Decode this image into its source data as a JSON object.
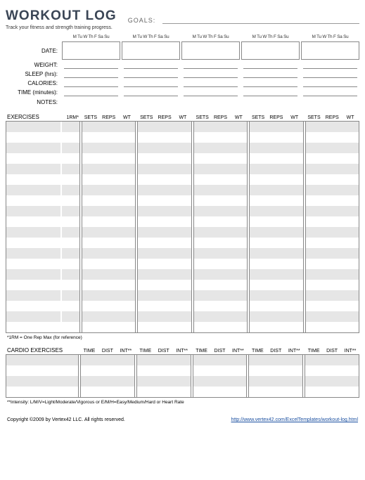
{
  "title": "WORKOUT LOG",
  "goals_label": "GOALS:",
  "subtitle": "Track your fitness and strength training progress.",
  "day_header": "M Tu W Th F Sa Su",
  "labels": {
    "date": "DATE:",
    "weight": "WEIGHT:",
    "sleep": "SLEEP (hrs):",
    "calories": "CALORIES:",
    "time": "TIME (minutes):",
    "notes": "NOTES:"
  },
  "exercises_section": {
    "title": "EXERCISES",
    "rm_label": "1RM*",
    "cols": [
      "SETS",
      "REPS",
      "WT"
    ],
    "row_count": 20,
    "footnote": "*1RM = One Rep Max (for reference)"
  },
  "cardio_section": {
    "title": "CARDIO EXERCISES",
    "cols": [
      "TIME",
      "DIST",
      "INT**"
    ],
    "row_count": 4,
    "footnote": "**Intensity: L/M/V=Light/Moderate/Vigorous or E/M/H=Easy/Medium/Hard or Heart Rate"
  },
  "footer": {
    "copyright": "Copyright ©2009 by Vertex42 LLC. All rights reserved.",
    "link": "http://www.vertex42.com/ExcelTemplates/workout-log.html"
  },
  "num_days": 5
}
